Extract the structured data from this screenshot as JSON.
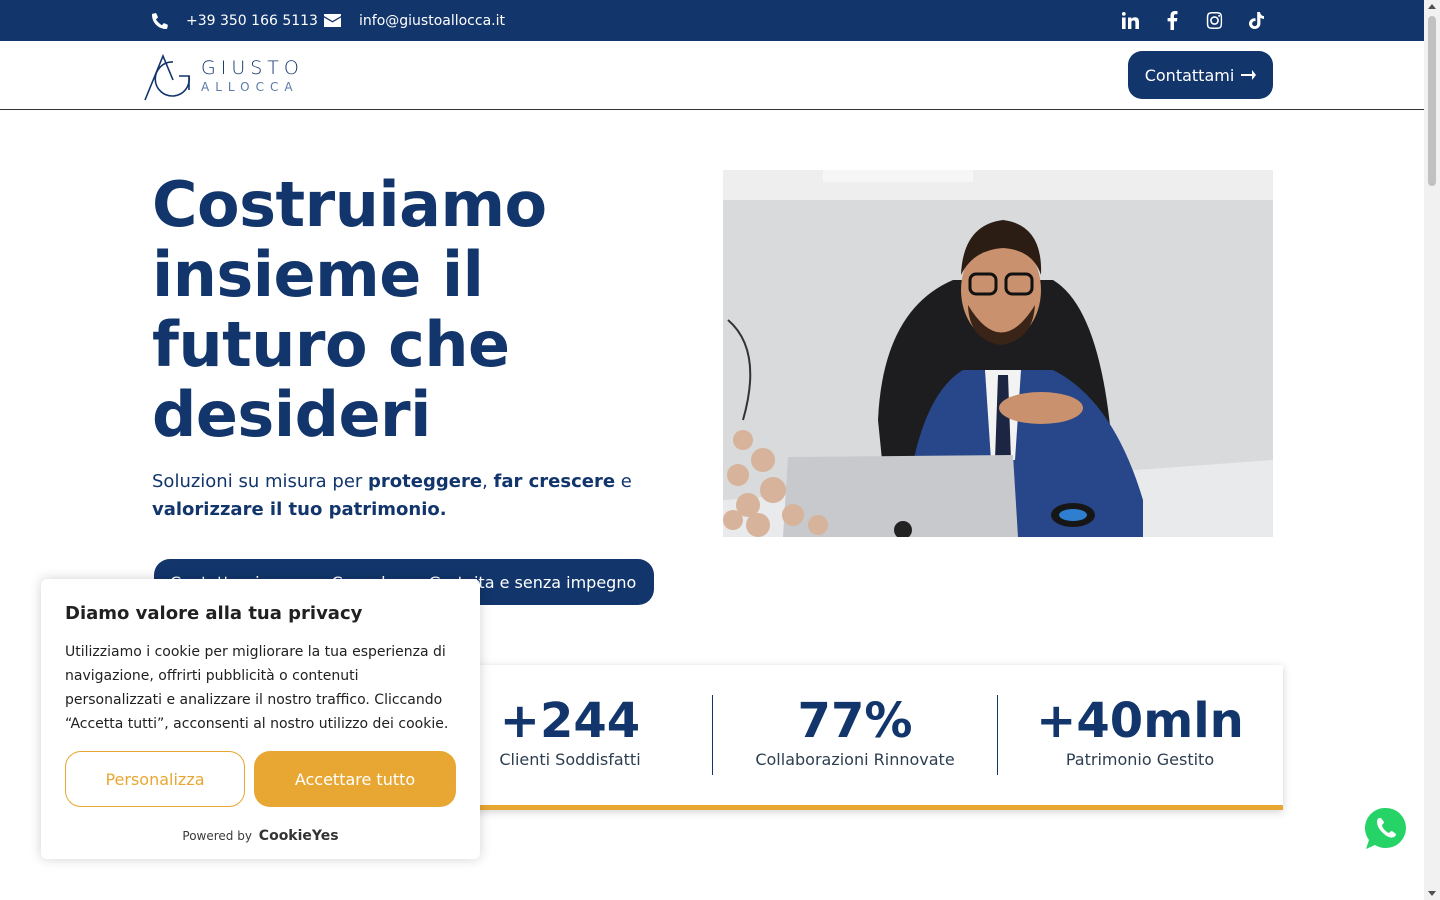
{
  "topbar": {
    "phone": "+39 350 166 5113",
    "email": "info@giustoallocca.it",
    "social": [
      "linkedin-icon",
      "facebook-icon",
      "instagram-icon",
      "tiktok-icon"
    ]
  },
  "header": {
    "logo_line1": "GIUSTO",
    "logo_line2": "ALLOCCA",
    "cta_label": "Contattami"
  },
  "hero": {
    "title": "Costruiamo insieme il futuro che desideri",
    "subtitle_prefix": "Soluzioni su misura per ",
    "subtitle_b1": "proteggere",
    "subtitle_sep": ", ",
    "subtitle_b2": "far crescere",
    "subtitle_mid": " e ",
    "subtitle_b3": "valorizzare il tuo patrimonio.",
    "button_label": "Contattami per una Consulenza Gratuita e senza impegno"
  },
  "stats": [
    {
      "value": "+244",
      "label": "Clienti Soddisfatti"
    },
    {
      "value": "77%",
      "label": "Collaborazioni Rinnovate"
    },
    {
      "value": "+40mln",
      "label": "Patrimonio Gestito"
    }
  ],
  "cookie": {
    "title": "Diamo valore alla tua privacy",
    "text": "Utilizziamo i cookie per migliorare la tua esperienza di navigazione, offrirti pubblicità o contenuti personalizzati e analizzare il nostro traffico. Cliccando “Accetta tutti”, acconsenti al nostro utilizzo dei cookie.",
    "customize_label": "Personalizza",
    "accept_label": "Accettare tutto",
    "powered_label": "Powered by",
    "powered_brand": "CookieYes"
  },
  "colors": {
    "brand_navy": "#12356b",
    "accent_gold": "#e8a732"
  }
}
